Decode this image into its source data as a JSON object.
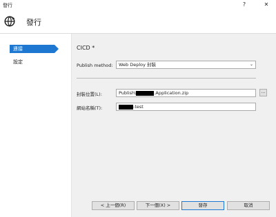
{
  "window": {
    "title": "發行",
    "help_label": "?",
    "close_label": "✕"
  },
  "header": {
    "title": "發行"
  },
  "sidebar": {
    "items": [
      {
        "label": "連接",
        "active": true
      },
      {
        "label": "設定",
        "active": false
      }
    ]
  },
  "main": {
    "profile_name": "CICD *",
    "publish_method": {
      "label": "Publish method:",
      "value": "Web Deploy 封裝"
    },
    "package_location": {
      "label": "封裝位置(L):",
      "prefix": "Publish\\",
      "suffix": ".Application.zip"
    },
    "site_name": {
      "label": "網站名稱(T):",
      "suffix": "-test"
    },
    "browse_label": "..."
  },
  "footer": {
    "prev_label": "< 上一個(R)",
    "next_label": "下一個(X) >",
    "save_label": "發存",
    "cancel_label": "取消"
  }
}
